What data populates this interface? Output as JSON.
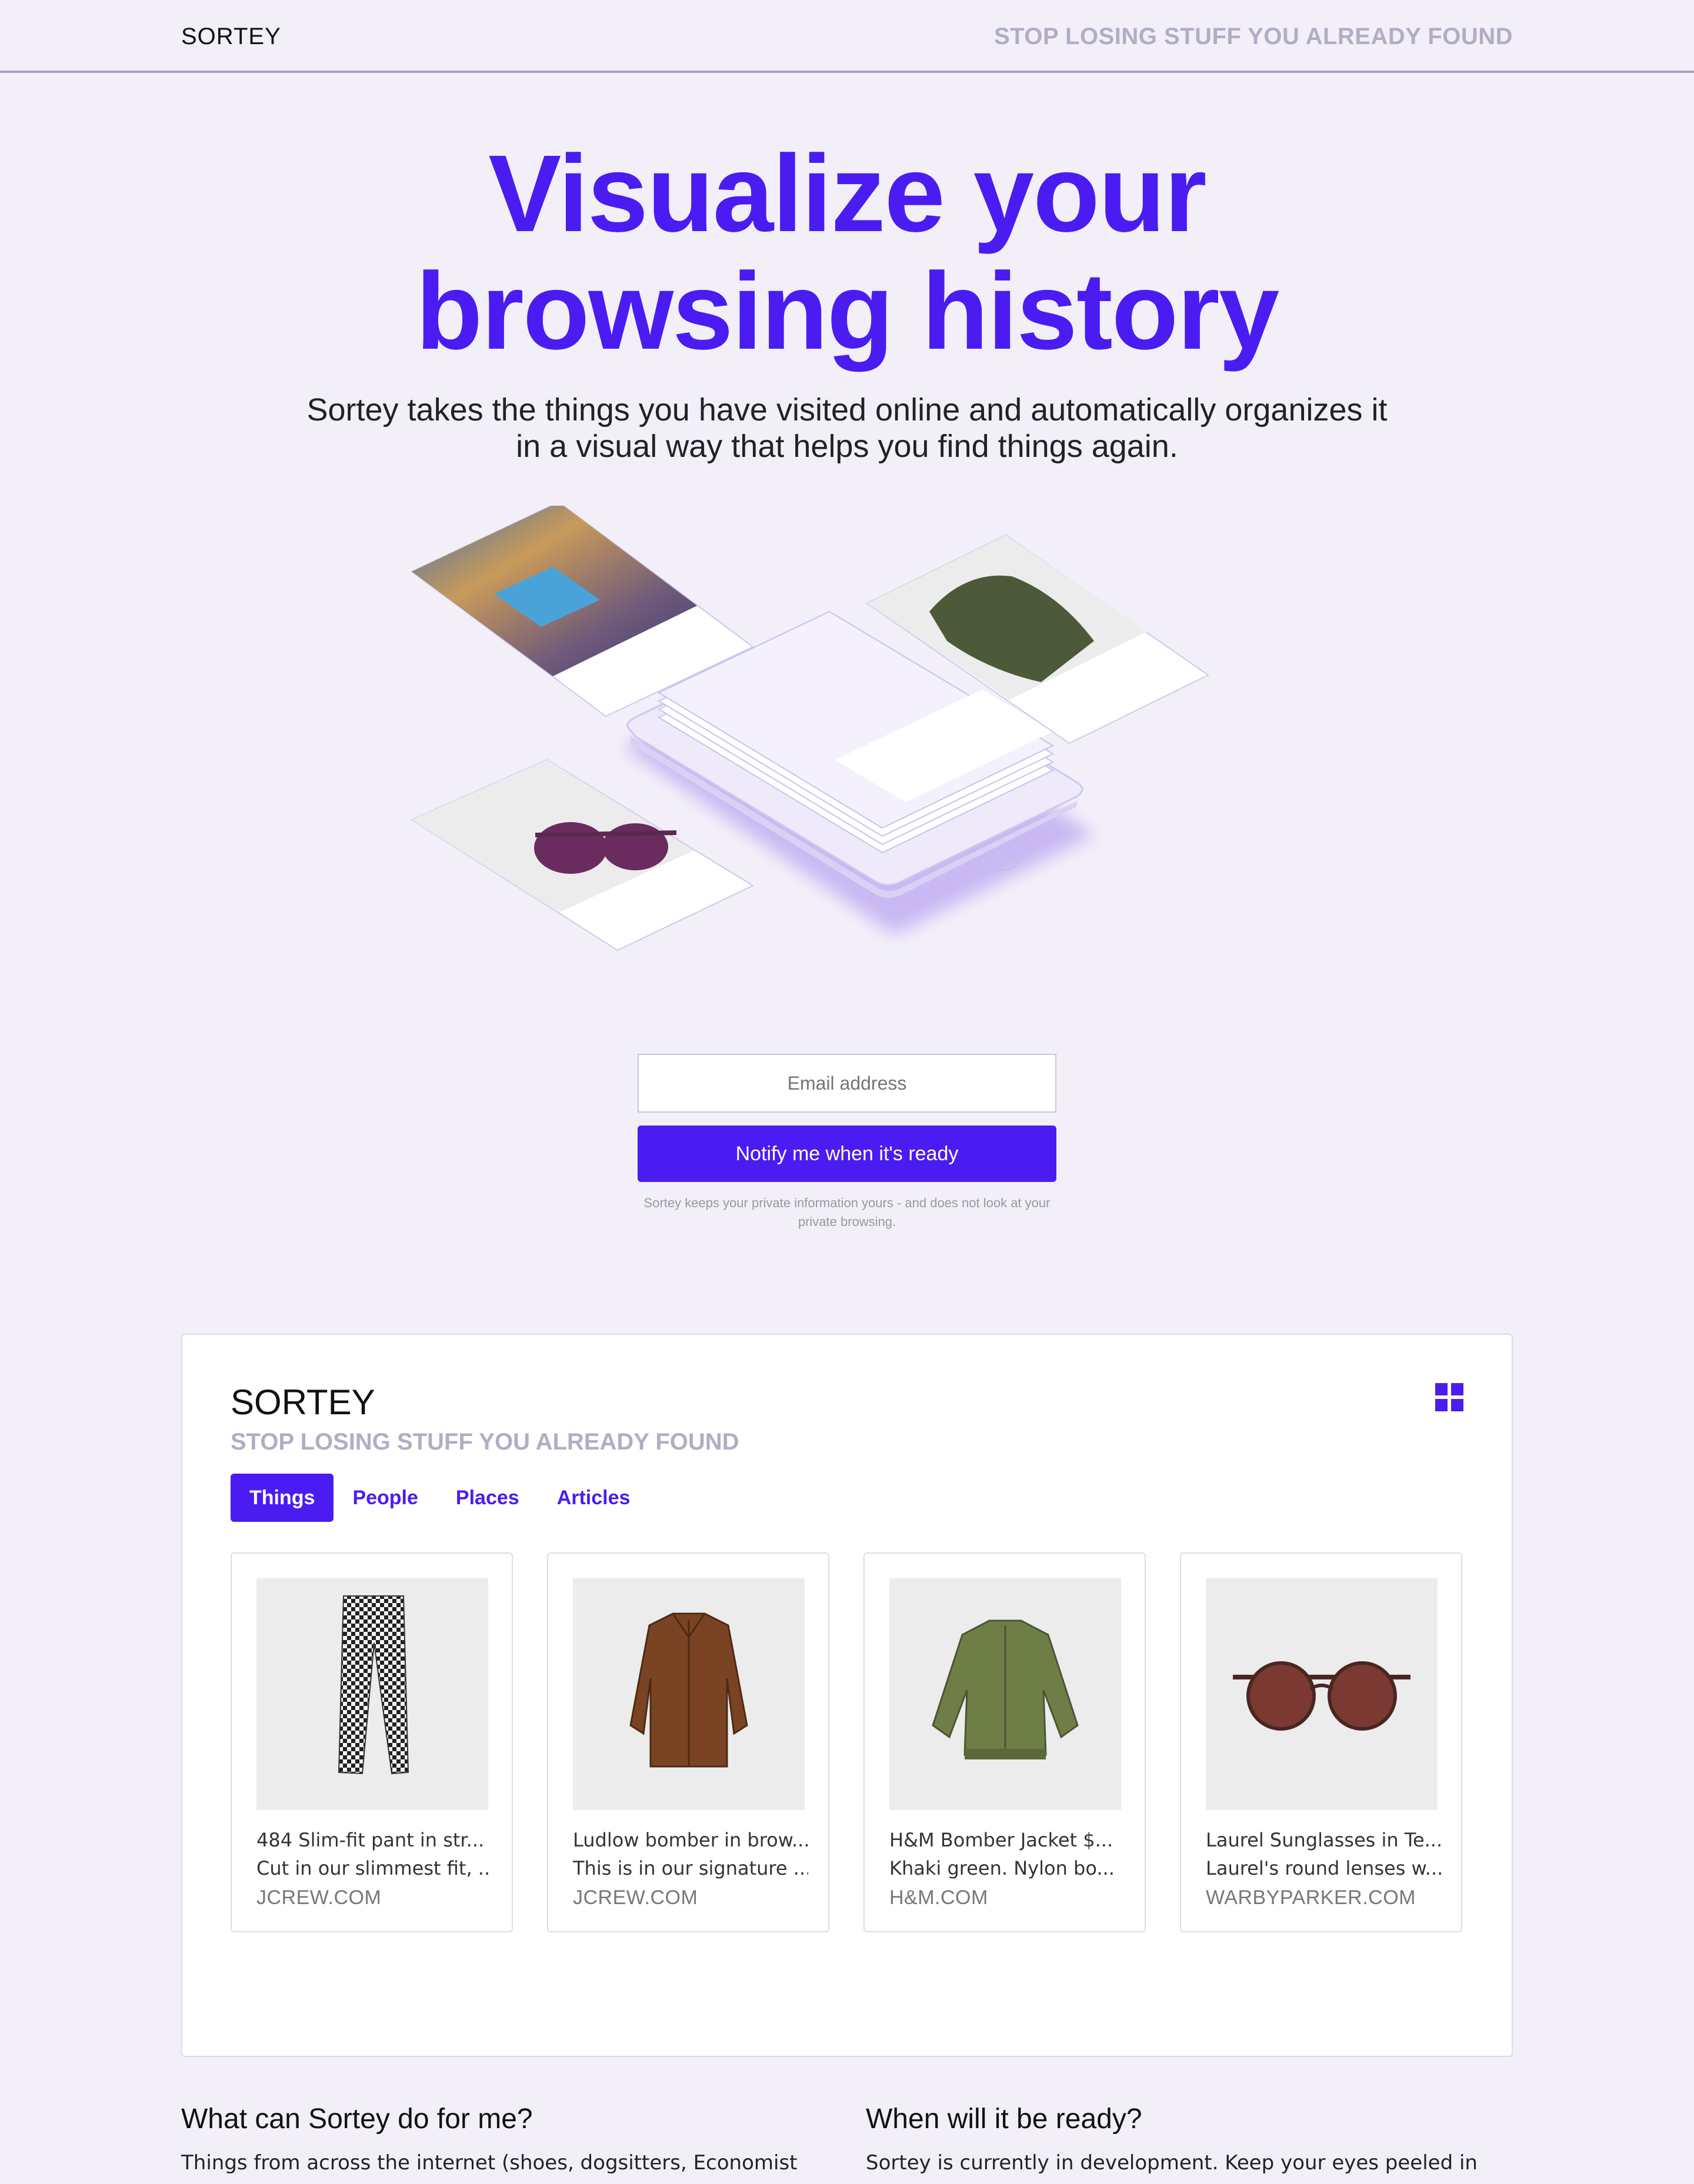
{
  "header": {
    "brand": "SORTEY",
    "tagline": "STOP LOSING STUFF YOU ALREADY FOUND"
  },
  "hero": {
    "title_line1": "Visualize your",
    "title_line2": "browsing history",
    "subtitle": "Sortey takes the things you have visited online and automatically organizes it in a visual way that helps you find things again."
  },
  "signup": {
    "email_placeholder": "Email address",
    "button_label": "Notify me when it's ready",
    "privacy_note": "Sortey keeps your private information yours - and does not look at your private browsing."
  },
  "demo": {
    "brand": "SORTEY",
    "tagline": "STOP LOSING STUFF YOU ALREADY FOUND",
    "view_icon": "grid-view-icon",
    "tabs": [
      {
        "label": "Things",
        "active": true
      },
      {
        "label": "People",
        "active": false
      },
      {
        "label": "Places",
        "active": false
      },
      {
        "label": "Articles",
        "active": false
      }
    ],
    "items": [
      {
        "image": "houndstooth-pants",
        "title": "484 Slim-fit pant in str...",
        "desc": "Cut in our slimmest fit, ...",
        "domain": "JCREW.COM"
      },
      {
        "image": "brown-corduroy-jacket",
        "title": "Ludlow bomber in brow...",
        "desc": "This is in our signature ...",
        "domain": "JCREW.COM"
      },
      {
        "image": "green-bomber-jacket",
        "title": "H&M Bomber Jacket $...",
        "desc": "Khaki green. Nylon bo...",
        "domain": "H&M.COM"
      },
      {
        "image": "brown-sunglasses",
        "title": "Laurel Sunglasses in Te...",
        "desc": "Laurel's round lenses w...",
        "domain": "WARBYPARKER.COM"
      }
    ]
  },
  "faq": [
    {
      "title": "What can Sortey do for me?",
      "text": "Things from across the internet (shoes, dogsitters, Economist articles)"
    },
    {
      "title": "When will it be ready?",
      "text": "Sortey is currently in development. Keep your eyes peeled in early"
    }
  ],
  "colors": {
    "accent": "#4a1cf2",
    "background": "#f2eff8",
    "muted": "#b2adc4"
  }
}
